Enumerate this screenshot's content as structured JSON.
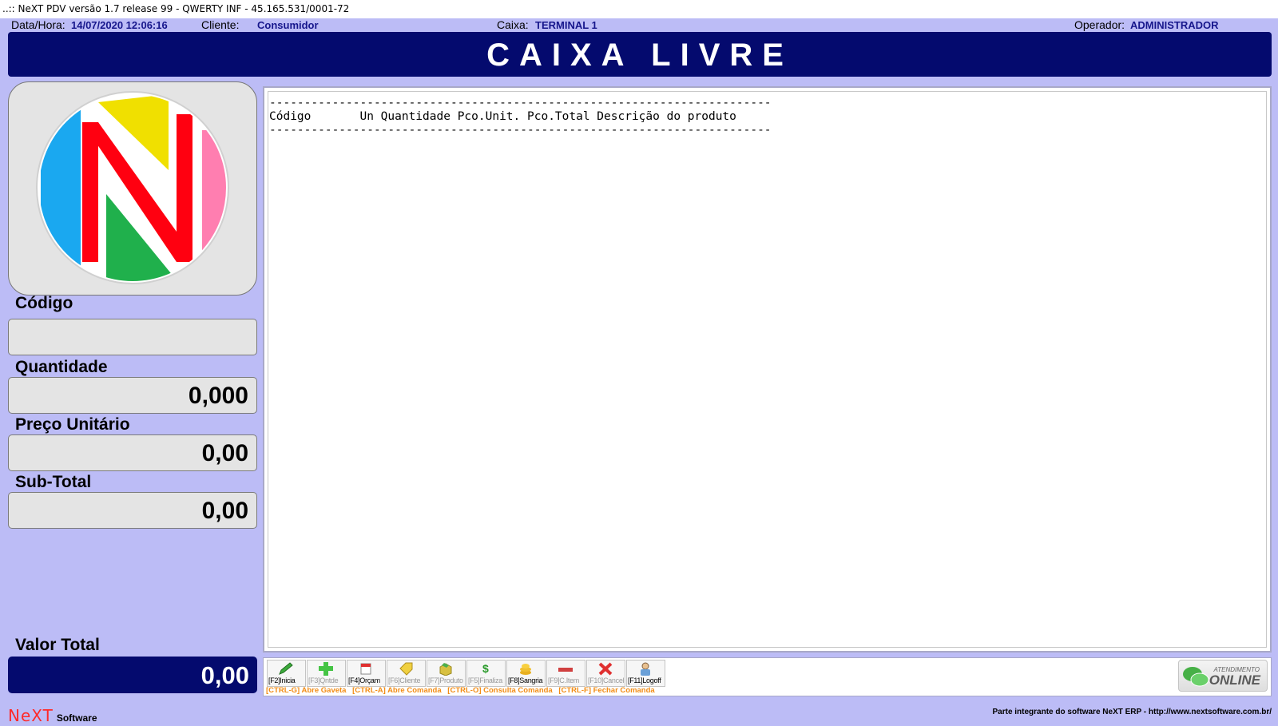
{
  "window": {
    "title": "..:: NeXT PDV versão 1.7 release 99 - QWERTY INF - 45.165.531/0001-72"
  },
  "info": {
    "datetime_label": "Data/Hora:",
    "datetime_value": "14/07/2020 12:06:16",
    "client_label": "Cliente:",
    "client_value": "Consumidor",
    "register_label": "Caixa:",
    "register_value": "TERMINAL 1",
    "operator_label": "Operador:",
    "operator_value": "ADMINISTRADOR"
  },
  "banner": {
    "status": "CAIXA LIVRE"
  },
  "fields": {
    "code_label": "Código",
    "code_value": "",
    "quantity_label": "Quantidade",
    "quantity_value": "0,000",
    "unit_price_label": "Preço Unitário",
    "unit_price_value": "0,00",
    "subtotal_label": "Sub-Total",
    "subtotal_value": "0,00",
    "total_label": "Valor Total",
    "total_value": "0,00"
  },
  "receipt": {
    "separator": "------------------------------------------------------------------------",
    "header": "Código       Un Quantidade Pco.Unit. Pco.Total Descrição do produto"
  },
  "toolbar": {
    "buttons": [
      {
        "label": "[F2]Inicia",
        "enabled": true,
        "icon": "pencil-icon"
      },
      {
        "label": "[F3]Qntde",
        "enabled": false,
        "icon": "plus-icon"
      },
      {
        "label": "[F4]Orçam",
        "enabled": true,
        "icon": "calendar-icon"
      },
      {
        "label": "[F6]Cliente",
        "enabled": false,
        "icon": "tag-icon"
      },
      {
        "label": "[F7]Produto",
        "enabled": false,
        "icon": "box-icon"
      },
      {
        "label": "[F5]Finaliza",
        "enabled": false,
        "icon": "dollar-icon"
      },
      {
        "label": "[F8]Sangria",
        "enabled": true,
        "icon": "coins-icon"
      },
      {
        "label": "[F9]C.Item",
        "enabled": false,
        "icon": "cancel-item-icon"
      },
      {
        "label": "[F10]Cancel",
        "enabled": false,
        "icon": "x-icon"
      },
      {
        "label": "[F11]Logoff",
        "enabled": true,
        "icon": "user-icon"
      }
    ],
    "shortcuts": [
      "[CTRL-G] Abre Gaveta",
      "[CTRL-A] Abre Comanda",
      "[CTRL-O] Consulta Comanda",
      "[CTRL-F] Fechar Comanda"
    ],
    "online_small": "ATENDIMENTO",
    "online_big": "ONLINE"
  },
  "footer": {
    "brand": "NeXT",
    "brand_sub": "Software",
    "note": "Parte integrante do software NeXT ERP - http://www.nextsoftware.com.br/"
  },
  "colors": {
    "background": "#bcbcf6",
    "banner": "#040a6e",
    "info_value": "#16168c",
    "shortcut": "#f28c14",
    "logo_yellow": "#f0e000",
    "logo_blue": "#1aa8f0",
    "logo_pink": "#ff7eb0",
    "logo_green": "#20b04c",
    "logo_red": "#ff0010"
  }
}
